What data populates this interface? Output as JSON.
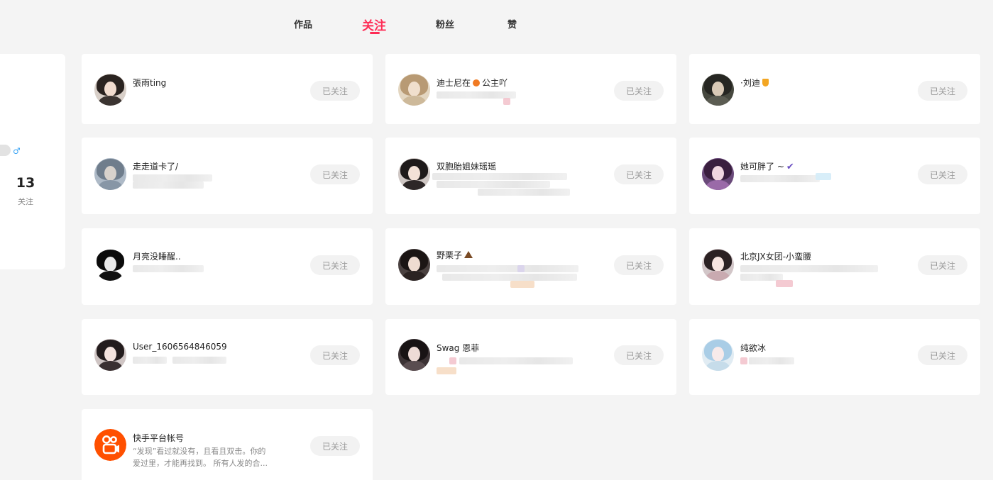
{
  "tabs": [
    {
      "label": "作品",
      "active": false
    },
    {
      "label": "关注",
      "active": true
    },
    {
      "label": "粉丝",
      "active": false
    },
    {
      "label": "赞",
      "active": false
    }
  ],
  "profile": {
    "gender_icon": "male-icon",
    "gender_glyph": "♂",
    "following_count": "13",
    "following_label": "关注"
  },
  "follow_button_label": "已关注",
  "accent_color": "#fe2c55",
  "users": [
    {
      "name": "張雨ting",
      "desc": "",
      "badge": ""
    },
    {
      "name": "迪士尼在",
      "name_suffix": "公主吖",
      "desc": "",
      "badge": "orange-emoji"
    },
    {
      "name": "·刘迪",
      "desc": "",
      "badge": "shield"
    },
    {
      "name": "走走道卡了/",
      "desc": "",
      "badge": ""
    },
    {
      "name": "双胞胎姐妹瑶瑶",
      "desc": "",
      "badge": ""
    },
    {
      "name": "她可胖了 ~",
      "desc": "",
      "badge": "check",
      "badge_glyph": "✔"
    },
    {
      "name": "月亮没睡醒..",
      "desc": "",
      "badge": ""
    },
    {
      "name": "野栗子",
      "desc": "",
      "badge": "chestnut"
    },
    {
      "name": "北京JX女团-小蛮腰",
      "desc": "",
      "badge": ""
    },
    {
      "name": "User_1606564846059",
      "desc": "",
      "badge": ""
    },
    {
      "name": "Swag 恩菲",
      "desc": "",
      "badge": ""
    },
    {
      "name": "纯欲冰",
      "desc": "",
      "badge": ""
    },
    {
      "name": "快手平台帐号",
      "desc_line1": "“发现”看过就没有，且看且双击。你的",
      "desc_line2": "爱过里，才能再找到。 所有人发的合...",
      "badge": "",
      "avatar_icon": "kuaishou-logo-icon"
    }
  ]
}
